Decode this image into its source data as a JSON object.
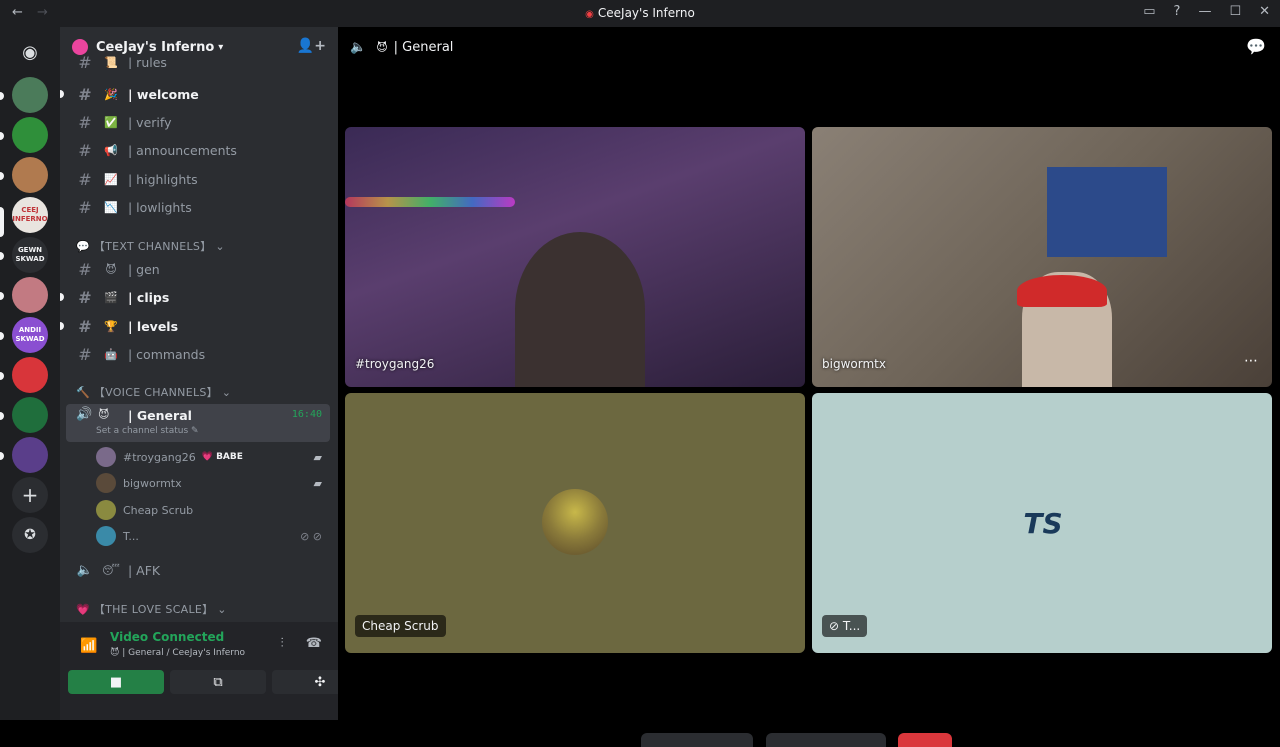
{
  "window": {
    "title": "CeeJay's Inferno",
    "nav_back": "←",
    "nav_forward": "→",
    "controls": [
      "inbox-icon",
      "help-icon",
      "minimize",
      "maximize",
      "close"
    ]
  },
  "servers": [
    {
      "name": "discord-home",
      "color": "#5865f2"
    },
    {
      "name": "server-1",
      "color": "#4b7b5a"
    },
    {
      "name": "server-2",
      "color": "#2f8f3a"
    },
    {
      "name": "server-3",
      "color": "#b07a4f"
    },
    {
      "name": "ceejay-inferno",
      "text": "CEEJ INFERNO",
      "color": "#c0353a"
    },
    {
      "name": "server-5",
      "text": "GEWN SKWAD",
      "color": "#2b2d31"
    },
    {
      "name": "server-6",
      "color": "#c27a82"
    },
    {
      "name": "server-7",
      "text": "ANDII SKWAD",
      "color": "#8a4fd1"
    },
    {
      "name": "server-8",
      "color": "#d8353a"
    },
    {
      "name": "server-9",
      "color": "#1f6e3c"
    },
    {
      "name": "server-10",
      "color": "#5a3e8a"
    }
  ],
  "server": {
    "name": "CeeJay's Inferno",
    "chevron": "⌄"
  },
  "channels": [
    {
      "label": "| rules",
      "emoji": "📜",
      "unread": false
    },
    {
      "label": "| welcome",
      "emoji": "🎉",
      "unread": true
    },
    {
      "label": "| verify",
      "emoji": "✅",
      "unread": false
    },
    {
      "label": "| announcements",
      "emoji": "📢",
      "unread": false
    },
    {
      "label": "| highlights",
      "emoji": "📈",
      "unread": false
    },
    {
      "label": "| lowlights",
      "emoji": "📉",
      "unread": false
    }
  ],
  "categories": {
    "text": "【TEXT CHANNELS】",
    "voice": "【VOICE CHANNELS】",
    "love": "【THE LOVE SCALE】"
  },
  "text_channels": [
    {
      "label": "| gen",
      "emoji": "😈",
      "unread": false
    },
    {
      "label": "| clips",
      "emoji": "🎬",
      "unread": true
    },
    {
      "label": "| levels",
      "emoji": "🏆",
      "unread": true
    },
    {
      "label": "| commands",
      "emoji": "🤖",
      "unread": false
    }
  ],
  "voice": {
    "channel": "| General",
    "emoji": "😈",
    "time": "16:40",
    "status": "Set a channel status",
    "users": [
      {
        "name": "#troygang26",
        "badge": "💗 BABE",
        "camera": true,
        "color": "#7a6a8a"
      },
      {
        "name": "bigwormtx",
        "badge": "",
        "camera": true,
        "color": "#5a4a3a"
      },
      {
        "name": "Cheap Scrub",
        "badge": "",
        "camera": false,
        "color": "#8a8a40"
      },
      {
        "name": "T...",
        "badge": "",
        "camera": false,
        "color": "#3a8aa8"
      }
    ],
    "afk": "| AFK",
    "afk_emoji": "😴"
  },
  "panel": {
    "connected": "Video Connected",
    "location": "| General / CeeJay's Inferno"
  },
  "main": {
    "channel": "| General",
    "tiles": [
      {
        "name": "#troygang26",
        "bg": "#3b2c4a"
      },
      {
        "name": "bigwormtx",
        "bg": "#6b5f52"
      },
      {
        "name": "Cheap Scrub",
        "bg": "#6c6840"
      },
      {
        "name": "T...",
        "bg": "#b6cfcc"
      }
    ]
  }
}
